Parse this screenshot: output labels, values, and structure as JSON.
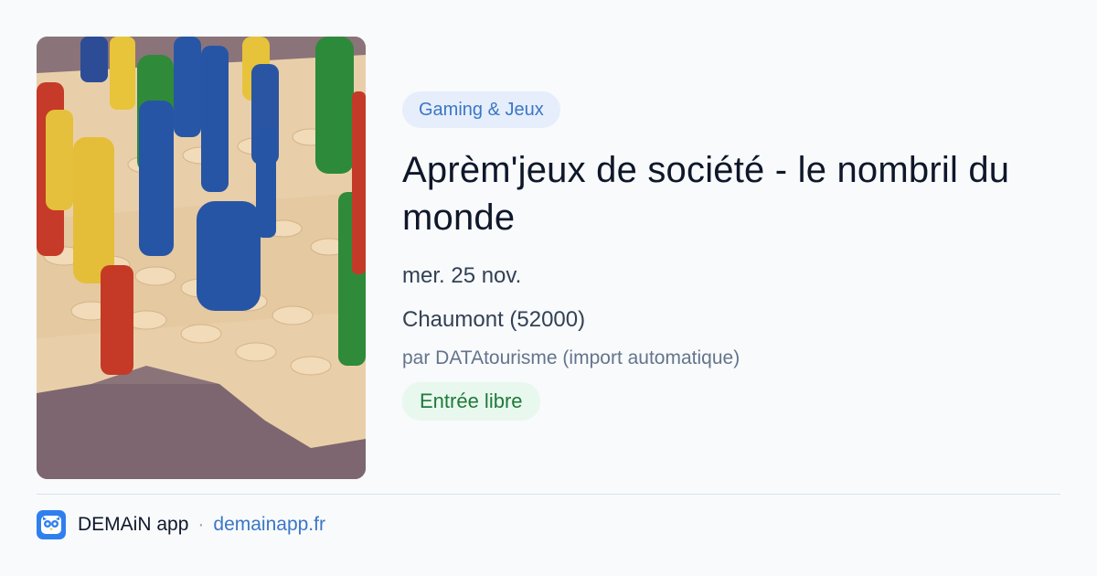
{
  "event": {
    "category": "Gaming & Jeux",
    "title": "Aprèm'jeux de société - le nombril du monde",
    "date": "mer. 25 nov.",
    "location": "Chaumont (52000)",
    "organizer": "par DATAtourisme (import automatique)",
    "price": "Entrée libre"
  },
  "footer": {
    "app_name": "DEMAiN app",
    "separator": "·",
    "url": "demainapp.fr"
  },
  "icons": {
    "app_logo": "owl-face-icon"
  }
}
